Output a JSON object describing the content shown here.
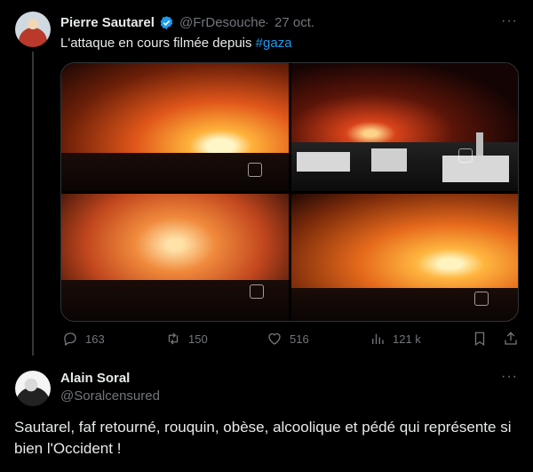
{
  "tweet": {
    "author_name": "Pierre Sautarel",
    "handle": "@FrDesouche",
    "separator": "·",
    "date": "27 oct.",
    "text_before": "L'attaque en cours filmée depuis ",
    "hashtag": "#gaza",
    "stats": {
      "replies": "163",
      "retweets": "150",
      "likes": "516",
      "views": "121 k"
    },
    "more_glyph": "···"
  },
  "reply": {
    "author_name": "Alain Soral",
    "handle": "@Soralcensured",
    "more_glyph": "···",
    "text": "Sautarel, faf retourné, rouquin, obèse, alcoolique et pédé qui représente si bien l'Occident !"
  },
  "colors": {
    "background": "#000000",
    "text_primary": "#e7e9ea",
    "text_secondary": "#71767b",
    "link": "#1d9bf0",
    "verified": "#1d9bf0"
  }
}
